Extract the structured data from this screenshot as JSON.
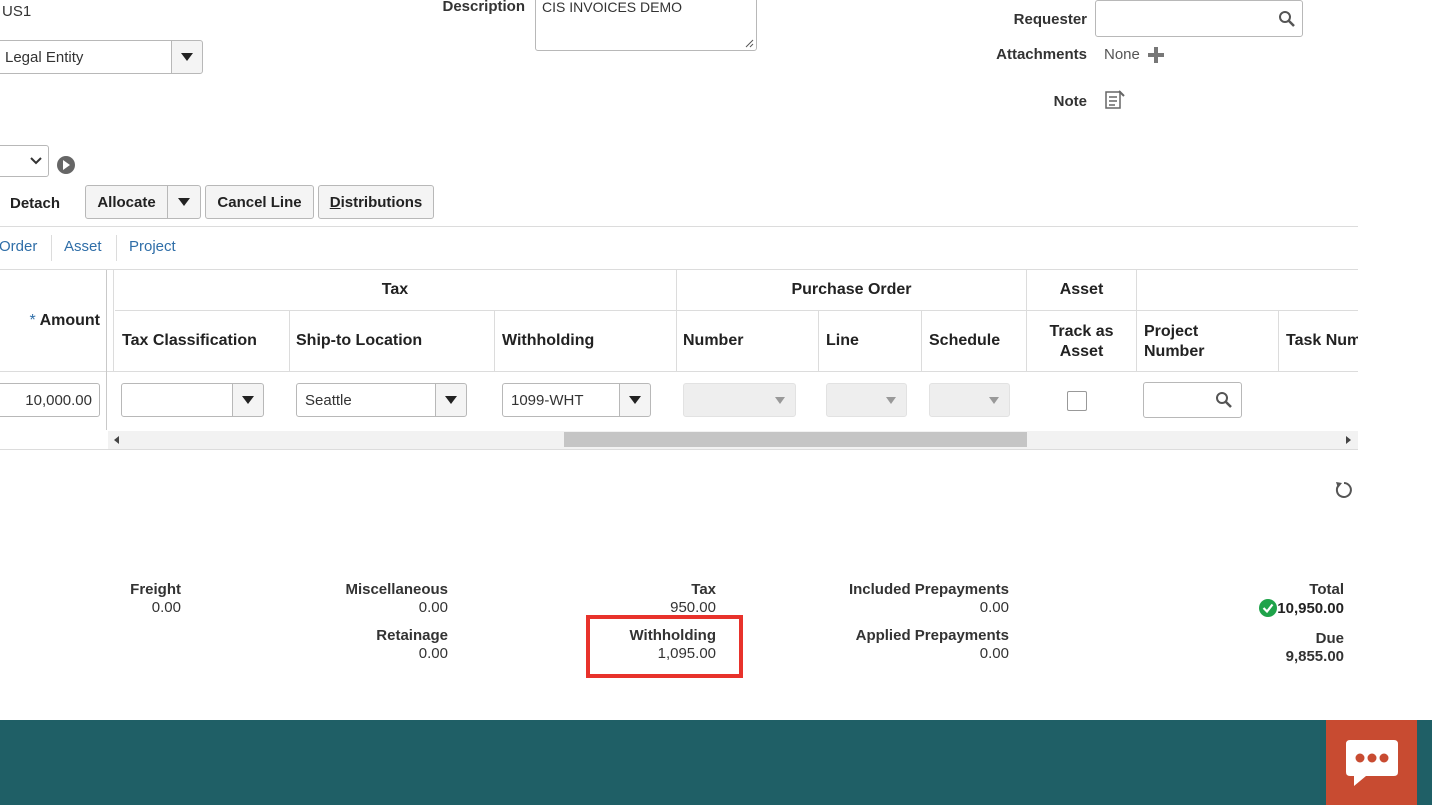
{
  "header": {
    "business_unit": "US1",
    "legal_entity_placeholder": "Legal Entity",
    "description_label": "Description",
    "description_value": "CIS INVOICES DEMO",
    "requester_label": "Requester",
    "attachments_label": "Attachments",
    "attachments_value": "None",
    "note_label": "Note"
  },
  "toolbar": {
    "detach": "Detach",
    "allocate": "Allocate",
    "cancel_line": "Cancel Line",
    "distributions_prefix": "D",
    "distributions_rest": "istributions"
  },
  "tabs": [
    "Order",
    "Asset",
    "Project"
  ],
  "table": {
    "amount_header": "Amount",
    "required_mark": "*",
    "groups": {
      "tax": "Tax",
      "purchase_order": "Purchase Order",
      "asset": "Asset"
    },
    "columns": {
      "tax_classification": "Tax Classification",
      "ship_to_location": "Ship-to Location",
      "withholding": "Withholding",
      "number": "Number",
      "line": "Line",
      "schedule": "Schedule",
      "track_as_asset_1": "Track as",
      "track_as_asset_2": "Asset",
      "project_number_1": "Project",
      "project_number_2": "Number",
      "task_number": "Task Num"
    },
    "row": {
      "amount": "10,000.00",
      "tax_classification": "",
      "ship_to_location": "Seattle",
      "withholding": "1099-WHT",
      "track_as_asset": false
    }
  },
  "totals": {
    "freight": {
      "label": "Freight",
      "value": "0.00"
    },
    "miscellaneous": {
      "label": "Miscellaneous",
      "value": "0.00"
    },
    "retainage": {
      "label": "Retainage",
      "value": "0.00"
    },
    "tax": {
      "label": "Tax",
      "value": "950.00"
    },
    "withholding": {
      "label": "Withholding",
      "value": "1,095.00"
    },
    "included_prepayments": {
      "label": "Included Prepayments",
      "value": "0.00"
    },
    "applied_prepayments": {
      "label": "Applied Prepayments",
      "value": "0.00"
    },
    "total": {
      "label": "Total",
      "value": "10,950.00"
    },
    "due": {
      "label": "Due",
      "value": "9,855.00"
    }
  },
  "colors": {
    "highlight_box": "#e8322b",
    "footer_teal": "#1f5f66",
    "chat_button": "#c84b31",
    "link": "#2f6ea8",
    "validated_green": "#1fa34a"
  },
  "icons": [
    "search-icon",
    "add-icon",
    "note-icon",
    "go-icon",
    "refresh-icon",
    "check-circle-icon",
    "chat-icon"
  ]
}
